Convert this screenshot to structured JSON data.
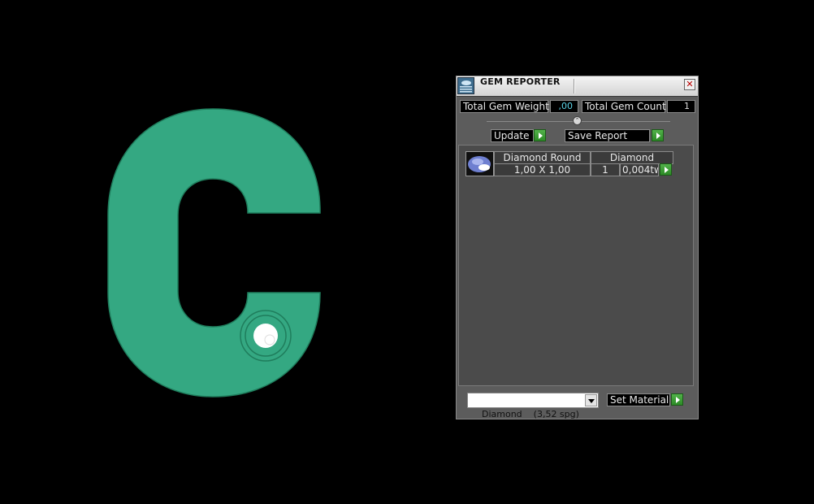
{
  "window": {
    "title": "GEM REPORTER",
    "close_glyph": "✕",
    "icon": "gem-reporter-icon"
  },
  "summary": {
    "total_weight_label": "Total Gem Weight",
    "total_weight_value": ",00",
    "total_count_label": "Total Gem Count",
    "total_count_value": "1"
  },
  "splitter": {
    "glyph": "⌃"
  },
  "toolbar": {
    "update_label": "Update",
    "save_report_label": "Save Report"
  },
  "gem_list": {
    "rows": [
      {
        "shape": "Diamond Round",
        "material": "Diamond",
        "size": "1,00 X 1,00",
        "count": "1",
        "weight": "0,004tw",
        "thumbnail_icon": "round-gem-icon"
      }
    ]
  },
  "material": {
    "selected": "Diamond    (3,52 spg)",
    "set_label": "Set Material"
  },
  "colors": {
    "model": "#34a882",
    "model_edge": "#1f7d5c",
    "accent_play": "#3aa034",
    "value_cyan": "#5ad2e6"
  }
}
